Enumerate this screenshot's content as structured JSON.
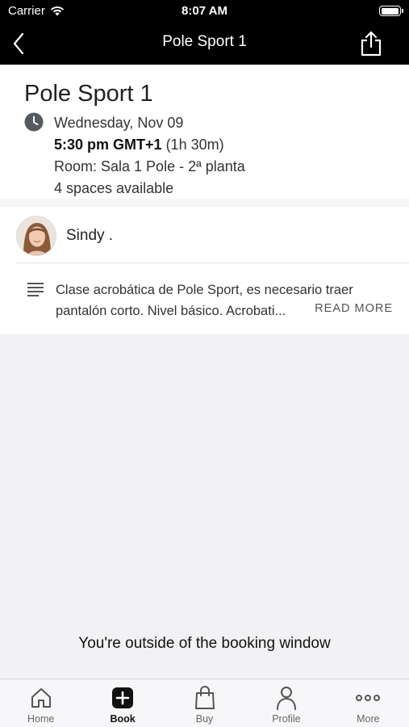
{
  "status_bar": {
    "carrier": "Carrier",
    "time": "8:07 AM",
    "battery_level": 1.0
  },
  "nav": {
    "title": "Pole Sport 1",
    "back_icon": "chevron-left-icon",
    "share_icon": "share-icon"
  },
  "class": {
    "title": "Pole Sport 1",
    "date": "Wednesday, Nov 09",
    "time": "5:30 pm GMT+1",
    "duration": "(1h 30m)",
    "room": "Room: Sala 1 Pole - 2ª planta",
    "spaces": "4 spaces available"
  },
  "instructor": {
    "name": "Sindy ."
  },
  "description": {
    "text": "Clase acrobática de Pole Sport, es necesario traer pantalón corto. Nivel básico. Acrobati...",
    "read_more": "READ MORE"
  },
  "booking": {
    "message": "You're outside of the booking window"
  },
  "tabs": [
    {
      "label": "Home",
      "icon": "home-icon",
      "active": false
    },
    {
      "label": "Book",
      "icon": "plus-icon",
      "active": true
    },
    {
      "label": "Buy",
      "icon": "shopping-bag-icon",
      "active": false
    },
    {
      "label": "Profile",
      "icon": "person-icon",
      "active": false
    },
    {
      "label": "More",
      "icon": "more-icon",
      "active": false
    }
  ],
  "colors": {
    "bar_bg": "#000000",
    "page_bg": "#f2f2f4",
    "active_tab": "#111111",
    "inactive_tab": "#666666"
  }
}
